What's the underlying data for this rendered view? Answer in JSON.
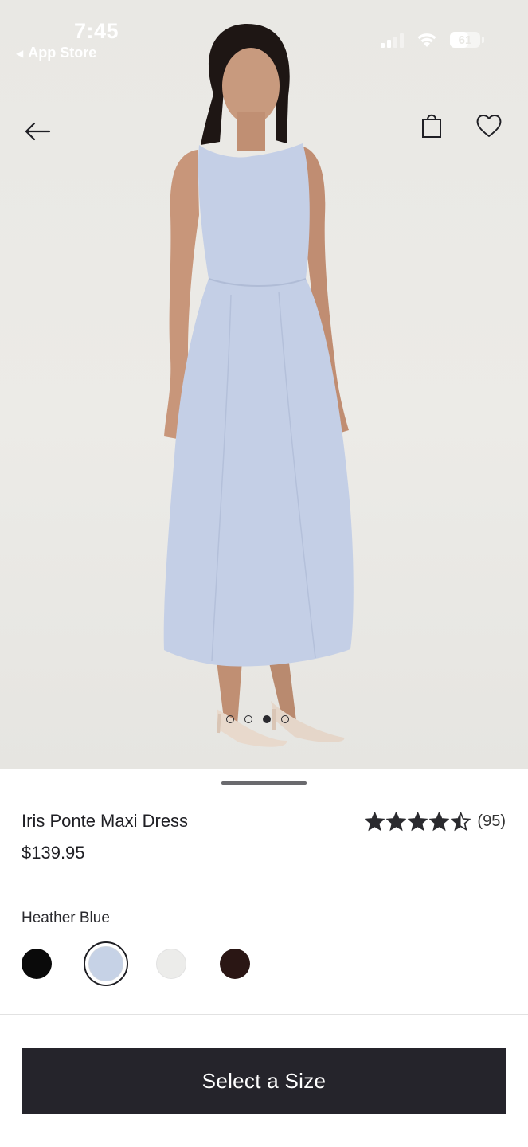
{
  "status_bar": {
    "time": "7:45",
    "back_app": "App Store",
    "battery": "61",
    "battery_level": 0.61
  },
  "header": {
    "back_icon": "arrow-left-icon",
    "bag_icon": "shopping-bag-icon",
    "favorite_icon": "heart-outline-icon"
  },
  "gallery": {
    "image_count": 4,
    "active_index": 2
  },
  "product": {
    "name": "Iris Ponte Maxi Dress",
    "price": "$139.95",
    "rating": 4.5,
    "review_count": "(95)"
  },
  "colors": {
    "selected_name": "Heather Blue",
    "options": [
      {
        "hex": "#0a0a0a"
      },
      {
        "hex": "#c6d2e6"
      },
      {
        "hex": "#ececea"
      },
      {
        "hex": "#2a1614"
      }
    ],
    "selected_index": 1
  },
  "cta": {
    "label": "Select a Size",
    "color": "#25242b"
  },
  "theme": {
    "dress_color": "#c4cfe6",
    "background": "#e9e8e4"
  }
}
